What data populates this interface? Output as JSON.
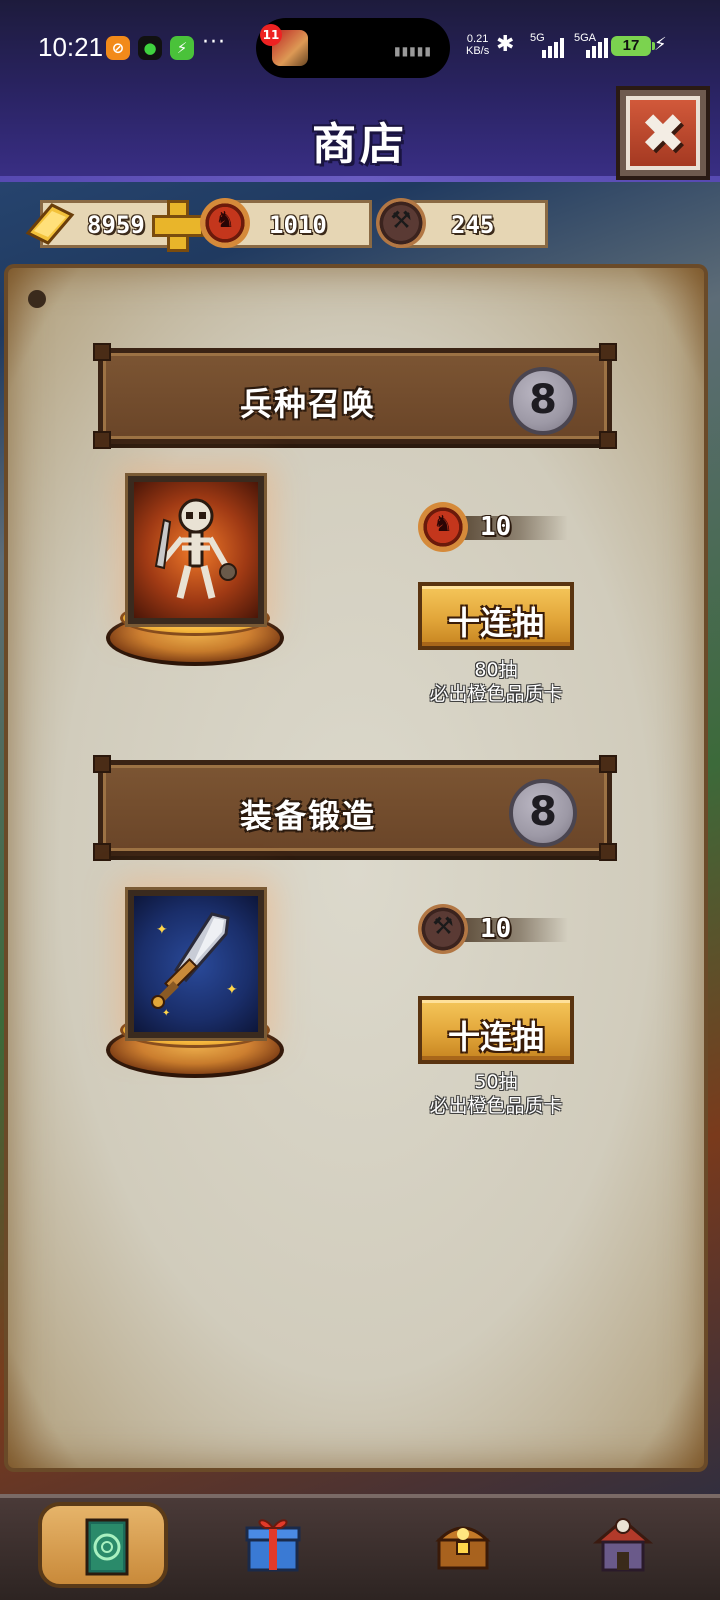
{
  "status_bar": {
    "time": "10:21",
    "app_icons": [
      "taobao-icon",
      "wechat-icon",
      "charge-app-icon"
    ],
    "more": "···",
    "island_badge": "11",
    "net_speed_value": "0.21",
    "net_speed_unit": "KB/s",
    "signal1_label": "5G",
    "signal2_label": "5GA",
    "battery": "17"
  },
  "header": {
    "title": "商店",
    "close_glyph": "✖"
  },
  "currencies": {
    "gold": "8959",
    "gems": "1010",
    "anvils": "245"
  },
  "sections": [
    {
      "title": "兵种召唤",
      "info_glyph": "8",
      "card_icon": "skeleton-warrior",
      "cost": "10",
      "cost_icon": "demon-coin-icon",
      "button_label": "十连抽",
      "guarantee_line1": "80抽",
      "guarantee_line2": "必出橙色品质卡"
    },
    {
      "title": "装备锻造",
      "info_glyph": "8",
      "card_icon": "sword",
      "cost": "10",
      "cost_icon": "anvil-coin-icon",
      "button_label": "十连抽",
      "guarantee_line1": "50抽",
      "guarantee_line2": "必出橙色品质卡"
    }
  ],
  "bottom_nav": [
    {
      "icon": "card-deck-icon",
      "active": true
    },
    {
      "icon": "gift-box-icon",
      "active": false
    },
    {
      "icon": "treasure-chest-icon",
      "active": false
    },
    {
      "icon": "barracks-house-icon",
      "active": false
    }
  ],
  "colors": {
    "header_bg": "#2b2466",
    "button_gold": "#e2a63a",
    "banner_brown": "#6a4528",
    "close_red": "#c04a2c"
  }
}
